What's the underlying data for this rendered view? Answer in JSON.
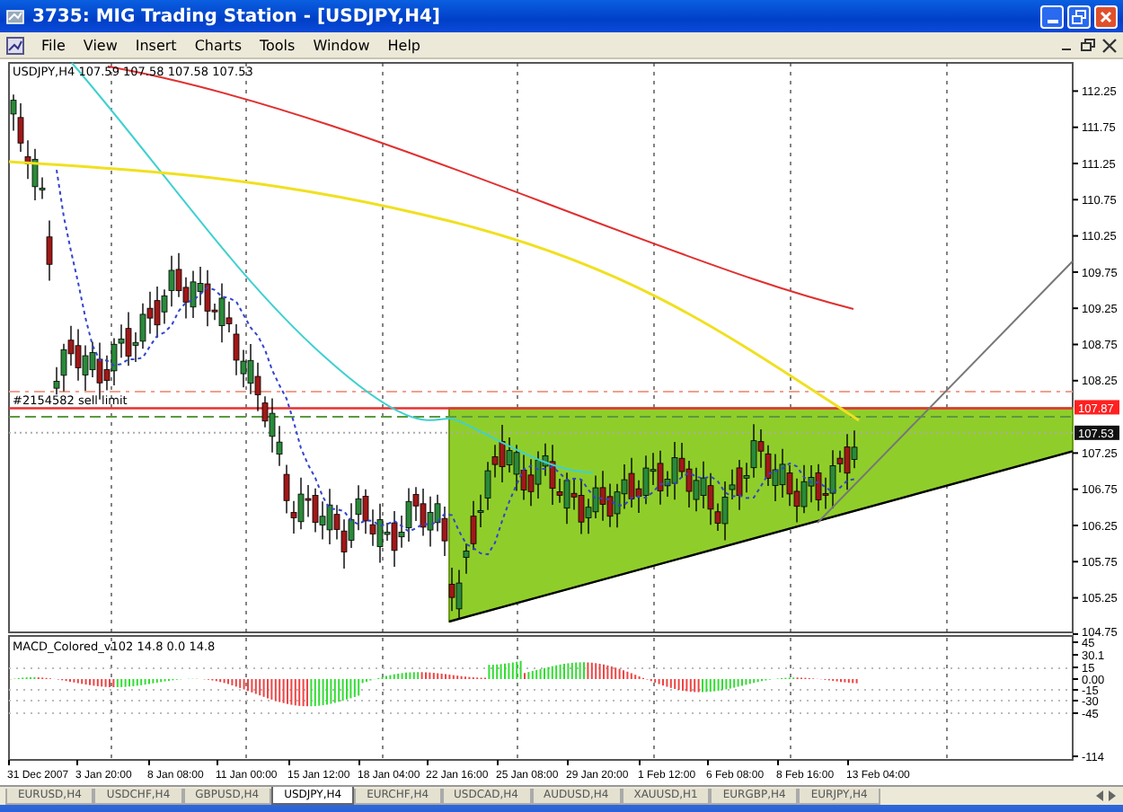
{
  "window": {
    "title": "3735: MIG Trading Station - [USDJPY,H4]"
  },
  "menu": [
    "File",
    "View",
    "Insert",
    "Charts",
    "Tools",
    "Window",
    "Help"
  ],
  "chart": {
    "label": "USDJPY,H4  107.59 107.58 107.58 107.53",
    "order_label": "#2154582 sell limit",
    "price_axis": [
      "112.25",
      "111.75",
      "111.25",
      "110.75",
      "110.25",
      "109.75",
      "109.25",
      "108.75",
      "108.25",
      "107.25",
      "106.75",
      "106.25",
      "105.75",
      "105.25",
      "104.75"
    ],
    "order_price": "107.87",
    "bid_price": "107.53",
    "indicator": {
      "label": "MACD_Colored_v102 14.8 0.0 14.8",
      "axis": [
        "45",
        "30.1",
        "15",
        "0.00",
        "-15",
        "-30",
        "-45",
        "-114"
      ]
    },
    "time_axis": [
      "31 Dec 2007",
      "3 Jan 20:00",
      "8 Jan 08:00",
      "11 Jan 00:00",
      "15 Jan 12:00",
      "18 Jan 04:00",
      "22 Jan 16:00",
      "25 Jan 08:00",
      "29 Jan 20:00",
      "1 Feb 12:00",
      "6 Feb 08:00",
      "8 Feb 16:00",
      "13 Feb 04:00"
    ]
  },
  "tabs": [
    {
      "label": "EURUSD,H4",
      "selected": false
    },
    {
      "label": "USDCHF,H4",
      "selected": false
    },
    {
      "label": "GBPUSD,H4",
      "selected": false
    },
    {
      "label": "USDJPY,H4",
      "selected": true
    },
    {
      "label": "EURCHF,H4",
      "selected": false
    },
    {
      "label": "USDCAD,H4",
      "selected": false
    },
    {
      "label": "AUDUSD,H4",
      "selected": false
    },
    {
      "label": "XAUUSD,H1",
      "selected": false
    },
    {
      "label": "EURGBP,H4",
      "selected": false
    },
    {
      "label": "EURJPY,H4",
      "selected": false
    }
  ]
}
